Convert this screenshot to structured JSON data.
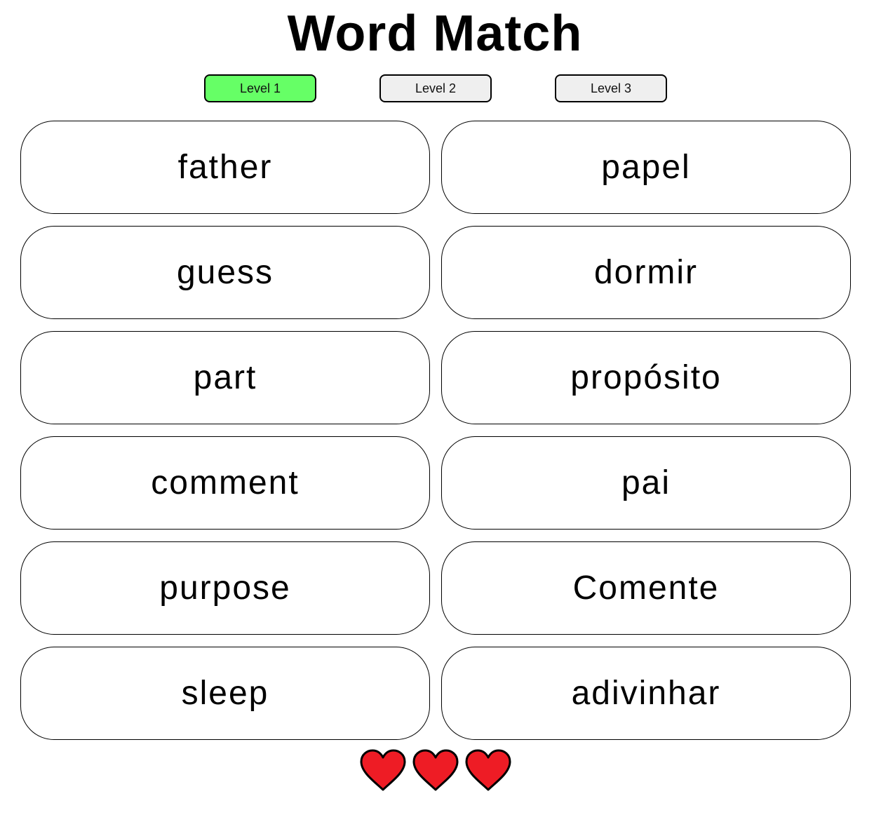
{
  "title": "Word Match",
  "levels": [
    {
      "label": "Level 1",
      "active": true
    },
    {
      "label": "Level 2",
      "active": false
    },
    {
      "label": "Level 3",
      "active": false
    }
  ],
  "left_words": [
    "father",
    "guess",
    "part",
    "comment",
    "purpose",
    "sleep"
  ],
  "right_words": [
    "papel",
    "dormir",
    "propósito",
    "pai",
    "Comente",
    "adivinhar"
  ],
  "lives": 3,
  "colors": {
    "active_level": "#66ff66",
    "inactive_level": "#efefef",
    "heart": "#ee1c25"
  }
}
